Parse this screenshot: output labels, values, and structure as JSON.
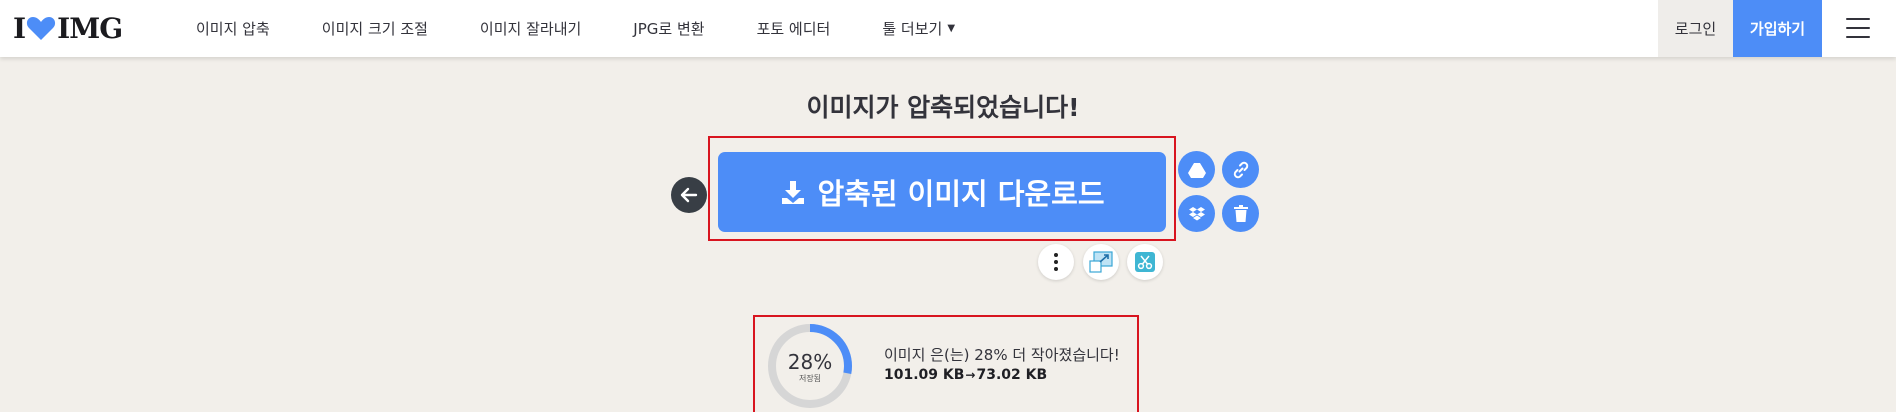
{
  "header": {
    "logo_left": "I",
    "logo_right": "IMG",
    "nav": [
      {
        "label": "이미지 압축"
      },
      {
        "label": "이미지 크기 조절"
      },
      {
        "label": "이미지 잘라내기"
      },
      {
        "label": "JPG로 변환"
      },
      {
        "label": "포토 에디터"
      },
      {
        "label": "툴 더보기"
      }
    ],
    "login_label": "로그인",
    "signup_label": "가입하기"
  },
  "main": {
    "title": "이미지가 압축되었습니다!",
    "download_label": "압축된 이미지 다운로드",
    "actions": [
      "google-drive-icon",
      "link-icon",
      "dropbox-icon",
      "trash-icon"
    ],
    "tools": [
      "more-options-icon",
      "resize-icon",
      "crop-icon"
    ]
  },
  "result": {
    "percent": "28%",
    "percent_value": 28,
    "saved_label": "저장됨",
    "message": "이미지 은(는) 28% 더 작아졌습니다!",
    "size_before": "101.09 KB",
    "arrow": "→",
    "size_after": "73.02 KB"
  },
  "colors": {
    "accent": "#4d8df7",
    "highlight_frame": "#d8141f",
    "background": "#f2efea",
    "dark": "#383e45"
  }
}
